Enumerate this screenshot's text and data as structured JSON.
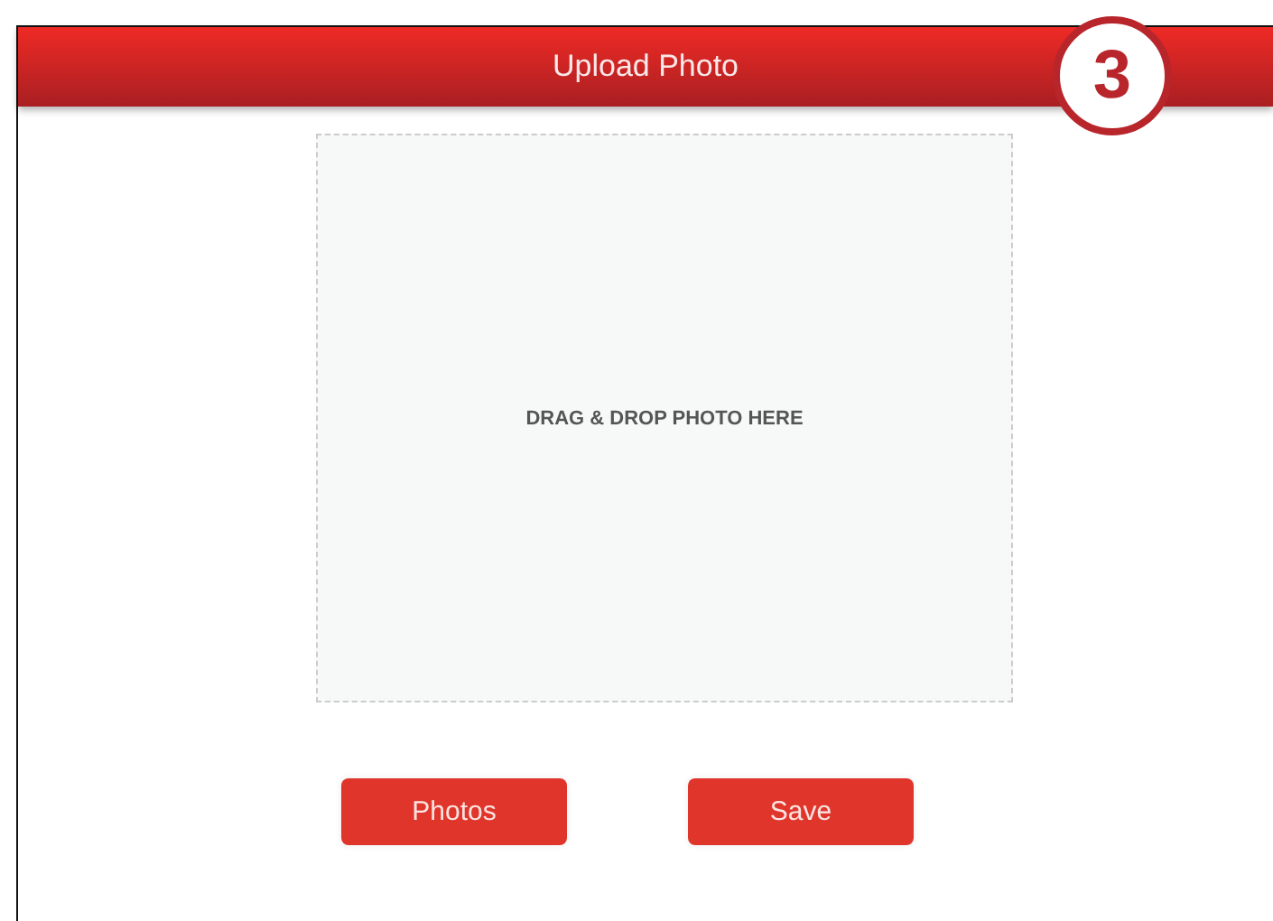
{
  "header": {
    "title": "Upload Photo"
  },
  "step_badge": "3",
  "drop_zone": {
    "label": "DRAG & DROP PHOTO HERE"
  },
  "buttons": [
    "Photos",
    "Save"
  ]
}
